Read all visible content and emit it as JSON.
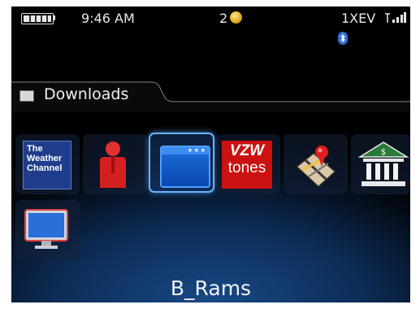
{
  "status_bar": {
    "time": "9:46 AM",
    "notification_count": "2",
    "network": "1XEV",
    "battery_icon": "battery-icon",
    "signal_icon": "signal-strength-icon",
    "bluetooth_icon": "bluetooth-icon"
  },
  "folder": {
    "label": "Downloads",
    "icon": "folder-icon"
  },
  "apps": {
    "weather": {
      "line1": "The",
      "line2": "Weather",
      "line3": "Channel"
    },
    "vzw": {
      "line1": "VZW",
      "line2": "tones"
    }
  },
  "device_name": "B_Rams",
  "colors": {
    "selection": "#6ab4ff",
    "vzw_red": "#cc1111",
    "weather_blue": "#1f3d8c",
    "background_blue": "#184a86"
  }
}
